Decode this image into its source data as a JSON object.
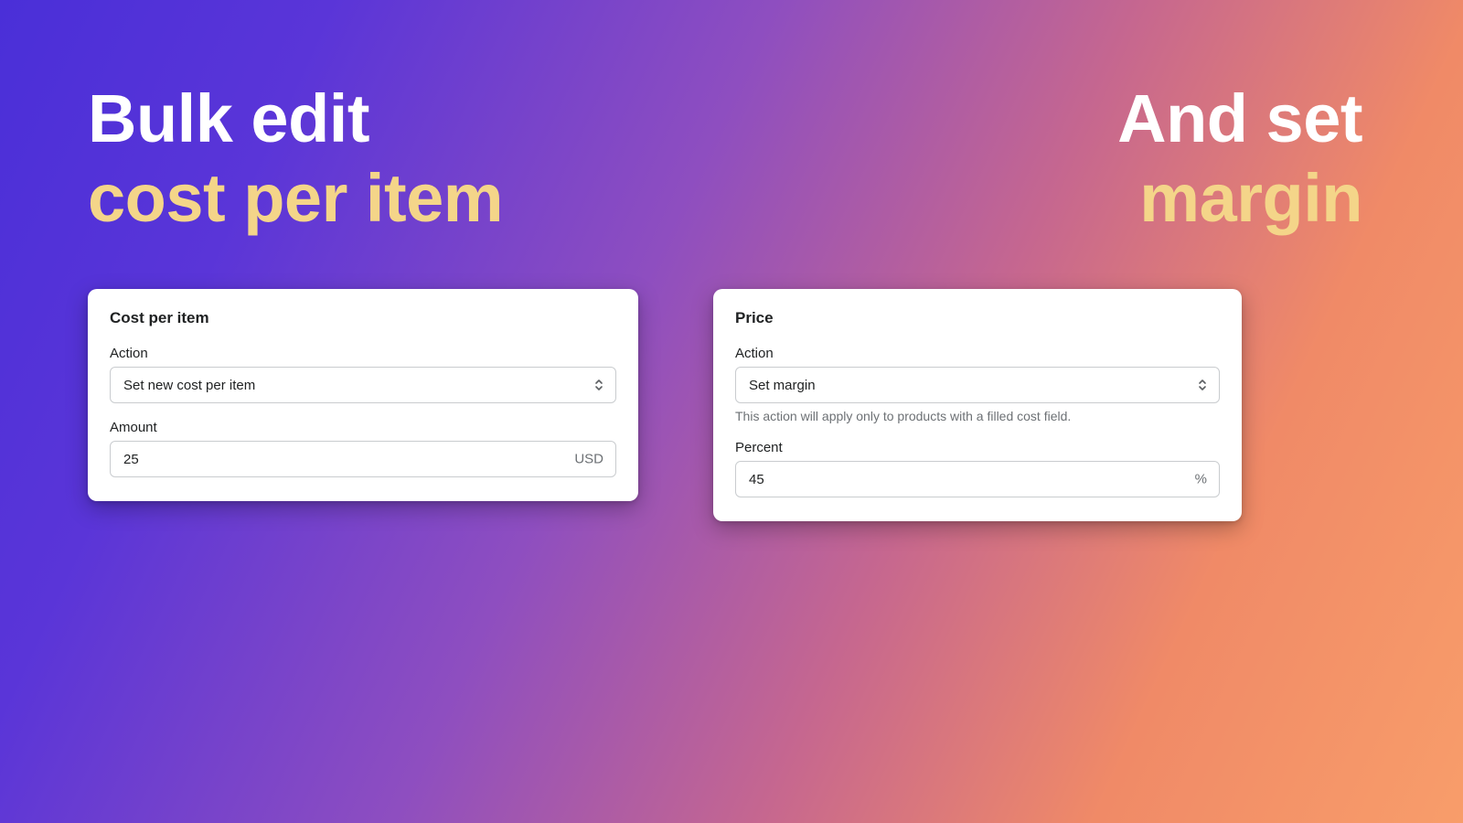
{
  "headlines": {
    "left": {
      "line1": "Bulk edit",
      "line2": "cost per item"
    },
    "right": {
      "line1": "And set",
      "line2": "margin"
    }
  },
  "card_cost": {
    "title": "Cost per item",
    "action_label": "Action",
    "action_value": "Set new cost per item",
    "amount_label": "Amount",
    "amount_value": "25",
    "amount_suffix": "USD"
  },
  "card_price": {
    "title": "Price",
    "action_label": "Action",
    "action_value": "Set margin",
    "help_text": "This action will apply only to products with a filled cost field.",
    "percent_label": "Percent",
    "percent_value": "45",
    "percent_suffix": "%"
  }
}
